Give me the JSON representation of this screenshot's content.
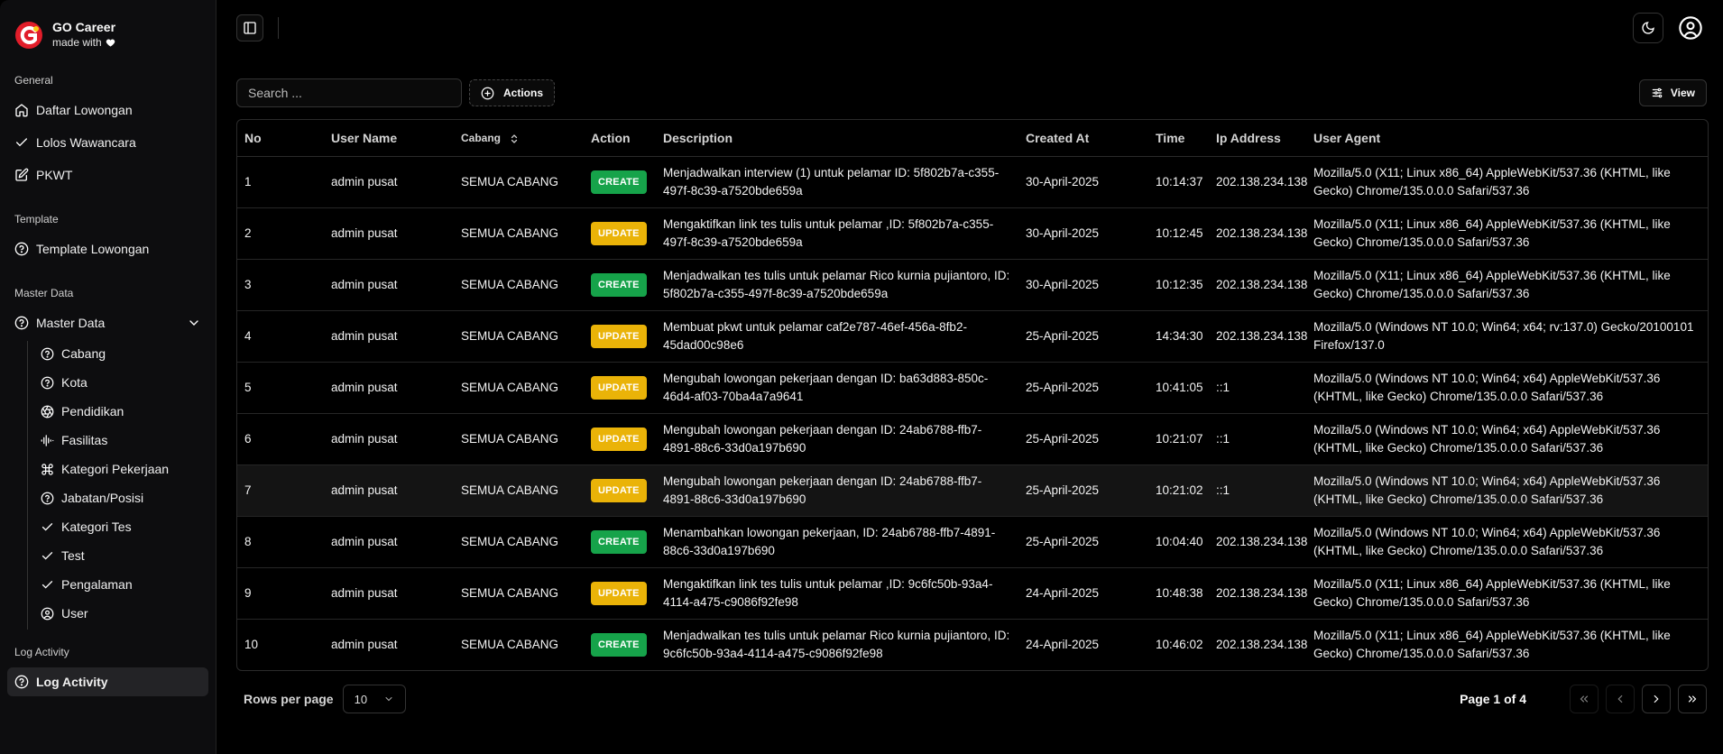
{
  "brand": {
    "title": "GO Career",
    "subtitle": "made with"
  },
  "colors": {
    "accent": "#e11d2a",
    "create": "#16a34a",
    "update": "#eab308"
  },
  "sidebar": {
    "groups": [
      {
        "label": "General",
        "items": [
          {
            "label": "Daftar Lowongan",
            "icon": "home-icon"
          },
          {
            "label": "Lolos Wawancara",
            "icon": "check-icon"
          },
          {
            "label": "PKWT",
            "icon": "edit-icon"
          }
        ]
      },
      {
        "label": "Template",
        "items": [
          {
            "label": "Template Lowongan",
            "icon": "help-circle-icon"
          }
        ]
      },
      {
        "label": "Master Data",
        "items": [
          {
            "label": "Master Data",
            "icon": "help-circle-icon"
          }
        ],
        "sub_items": [
          {
            "label": "Cabang",
            "icon": "help-circle-icon"
          },
          {
            "label": "Kota",
            "icon": "help-circle-icon"
          },
          {
            "label": "Pendidikan",
            "icon": "aperture-icon"
          },
          {
            "label": "Fasilitas",
            "icon": "audio-wave-icon"
          },
          {
            "label": "Kategori Pekerjaan",
            "icon": "command-icon"
          },
          {
            "label": "Jabatan/Posisi",
            "icon": "help-circle-icon"
          },
          {
            "label": "Kategori Tes",
            "icon": "check-icon"
          },
          {
            "label": "Test",
            "icon": "check-icon"
          },
          {
            "label": "Pengalaman",
            "icon": "check-icon"
          },
          {
            "label": "User",
            "icon": "user-circle-icon"
          }
        ]
      },
      {
        "label": "Log Activity",
        "items": [
          {
            "label": "Log Activity",
            "icon": "help-circle-icon",
            "active": true
          }
        ]
      }
    ]
  },
  "toolbar": {
    "search_placeholder": "Search ...",
    "actions_label": "Actions",
    "view_label": "View"
  },
  "table": {
    "headers": [
      "No",
      "User Name",
      "Cabang",
      "Action",
      "Description",
      "Created At",
      "Time",
      "Ip Address",
      "User Agent"
    ],
    "rows": [
      [
        "1",
        "admin pusat",
        "SEMUA CABANG",
        "CREATE",
        "Menjadwalkan interview (1) untuk pelamar ID: 5f802b7a-c355-497f-8c39-a7520bde659a",
        "30-April-2025",
        "10:14:37",
        "202.138.234.138",
        "Mozilla/5.0 (X11; Linux x86_64) AppleWebKit/537.36 (KHTML, like Gecko) Chrome/135.0.0.0 Safari/537.36"
      ],
      [
        "2",
        "admin pusat",
        "SEMUA CABANG",
        "UPDATE",
        "Mengaktifkan link tes tulis untuk pelamar ,ID: 5f802b7a-c355-497f-8c39-a7520bde659a",
        "30-April-2025",
        "10:12:45",
        "202.138.234.138",
        "Mozilla/5.0 (X11; Linux x86_64) AppleWebKit/537.36 (KHTML, like Gecko) Chrome/135.0.0.0 Safari/537.36"
      ],
      [
        "3",
        "admin pusat",
        "SEMUA CABANG",
        "CREATE",
        "Menjadwalkan tes tulis untuk pelamar Rico kurnia pujiantoro, ID: 5f802b7a-c355-497f-8c39-a7520bde659a",
        "30-April-2025",
        "10:12:35",
        "202.138.234.138",
        "Mozilla/5.0 (X11; Linux x86_64) AppleWebKit/537.36 (KHTML, like Gecko) Chrome/135.0.0.0 Safari/537.36"
      ],
      [
        "4",
        "admin pusat",
        "SEMUA CABANG",
        "UPDATE",
        "Membuat pkwt untuk pelamar caf2e787-46ef-456a-8fb2-45dad00c98e6",
        "25-April-2025",
        "14:34:30",
        "202.138.234.138",
        "Mozilla/5.0 (Windows NT 10.0; Win64; x64; rv:137.0) Gecko/20100101 Firefox/137.0"
      ],
      [
        "5",
        "admin pusat",
        "SEMUA CABANG",
        "UPDATE",
        "Mengubah lowongan pekerjaan dengan ID: ba63d883-850c-46d4-af03-70ba4a7a9641",
        "25-April-2025",
        "10:41:05",
        "::1",
        "Mozilla/5.0 (Windows NT 10.0; Win64; x64) AppleWebKit/537.36 (KHTML, like Gecko) Chrome/135.0.0.0 Safari/537.36"
      ],
      [
        "6",
        "admin pusat",
        "SEMUA CABANG",
        "UPDATE",
        "Mengubah lowongan pekerjaan dengan ID: 24ab6788-ffb7-4891-88c6-33d0a197b690",
        "25-April-2025",
        "10:21:07",
        "::1",
        "Mozilla/5.0 (Windows NT 10.0; Win64; x64) AppleWebKit/537.36 (KHTML, like Gecko) Chrome/135.0.0.0 Safari/537.36"
      ],
      [
        "7",
        "admin pusat",
        "SEMUA CABANG",
        "UPDATE",
        "Mengubah lowongan pekerjaan dengan ID: 24ab6788-ffb7-4891-88c6-33d0a197b690",
        "25-April-2025",
        "10:21:02",
        "::1",
        "Mozilla/5.0 (Windows NT 10.0; Win64; x64) AppleWebKit/537.36 (KHTML, like Gecko) Chrome/135.0.0.0 Safari/537.36"
      ],
      [
        "8",
        "admin pusat",
        "SEMUA CABANG",
        "CREATE",
        "Menambahkan lowongan pekerjaan, ID: 24ab6788-ffb7-4891-88c6-33d0a197b690",
        "25-April-2025",
        "10:04:40",
        "202.138.234.138",
        "Mozilla/5.0 (Windows NT 10.0; Win64; x64) AppleWebKit/537.36 (KHTML, like Gecko) Chrome/135.0.0.0 Safari/537.36"
      ],
      [
        "9",
        "admin pusat",
        "SEMUA CABANG",
        "UPDATE",
        "Mengaktifkan link tes tulis untuk pelamar ,ID: 9c6fc50b-93a4-4114-a475-c9086f92fe98",
        "24-April-2025",
        "10:48:38",
        "202.138.234.138",
        "Mozilla/5.0 (X11; Linux x86_64) AppleWebKit/537.36 (KHTML, like Gecko) Chrome/135.0.0.0 Safari/537.36"
      ],
      [
        "10",
        "admin pusat",
        "SEMUA CABANG",
        "CREATE",
        "Menjadwalkan tes tulis untuk pelamar Rico kurnia pujiantoro, ID: 9c6fc50b-93a4-4114-a475-c9086f92fe98",
        "24-April-2025",
        "10:46:02",
        "202.138.234.138",
        "Mozilla/5.0 (X11; Linux x86_64) AppleWebKit/537.36 (KHTML, like Gecko) Chrome/135.0.0.0 Safari/537.36"
      ]
    ]
  },
  "pagination": {
    "rows_per_page_label": "Rows per page",
    "rows_per_page_value": "10",
    "page_info": "Page 1 of 4"
  }
}
